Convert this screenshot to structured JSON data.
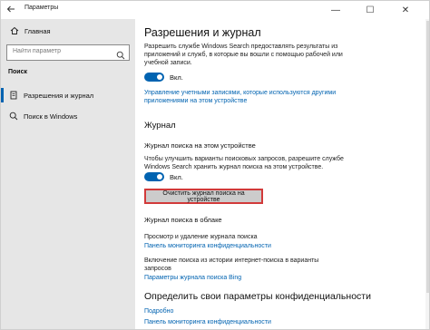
{
  "window": {
    "title": "Параметры",
    "back_icon": "back-arrow-icon",
    "min_glyph": "—",
    "max_glyph": "☐",
    "close_glyph": "✕"
  },
  "sidebar": {
    "home_label": "Главная",
    "search_placeholder": "Найти параметр",
    "section_label": "Поиск",
    "items": [
      {
        "label": "Разрешения и журнал",
        "icon": "permissions-icon",
        "active": true
      },
      {
        "label": "Поиск в Windows",
        "icon": "search-windows-icon",
        "active": false
      }
    ]
  },
  "main": {
    "title": "Разрешения и журнал",
    "intro_line1": "Разрешить службе Windows Search предоставлять результаты из",
    "intro_line2": "приложений и служб, в которые вы вошли с помощью рабочей или",
    "intro_line3": "учебной записи.",
    "toggle1_label": "Вкл.",
    "link_accounts_line1": "Управление учетными записями, которые используются другими",
    "link_accounts_line2": "приложениями на этом устройстве",
    "journal_heading": "Журнал",
    "device_history_heading": "Журнал поиска на этом устройстве",
    "device_history_line1": "Чтобы улучшить варианты поисковых запросов, разрешите службе",
    "device_history_line2": "Windows Search хранить журнал поиска на этом устройстве.",
    "toggle2_label": "Вкл.",
    "clear_button": "Очистить журнал поиска на устройстве",
    "cloud_heading": "Журнал поиска в облаке",
    "cloud_view_text": "Просмотр и удаление журнала поиска",
    "cloud_view_link": "Панель мониторинга конфиденциальности",
    "cloud_include_line1": "Включение поиска из истории интернет-поиска в варианты",
    "cloud_include_line2": "запросов",
    "cloud_include_link": "Параметры журнала поиска Bing",
    "privacy_heading": "Определить свои параметры конфиденциальности",
    "more_link": "Подробно",
    "privacy_dashboard_link": "Панель мониторинга конфиденциальности"
  },
  "colors": {
    "accent": "#0063b1",
    "sidebar_bg": "#e6e6e6",
    "highlight_border": "#d23a3a"
  }
}
